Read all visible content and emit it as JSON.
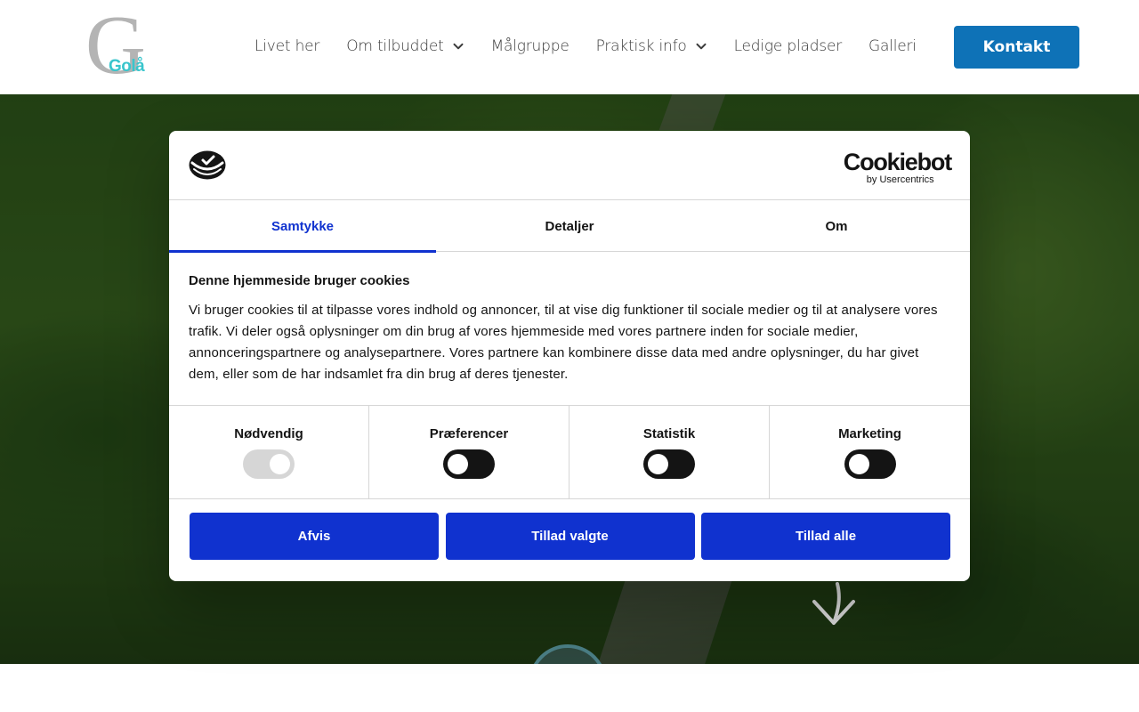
{
  "header": {
    "logo": {
      "letter": "G",
      "text": "Golå"
    },
    "nav": [
      {
        "label": "Livet her",
        "dropdown": false
      },
      {
        "label": "Om tilbuddet",
        "dropdown": true
      },
      {
        "label": "Målgruppe",
        "dropdown": false
      },
      {
        "label": "Praktisk info",
        "dropdown": true
      },
      {
        "label": "Ledige pladser",
        "dropdown": false
      },
      {
        "label": "Galleri",
        "dropdown": false
      }
    ],
    "cta_label": "Kontakt"
  },
  "cookie_dialog": {
    "brand": {
      "name": "Cookiebot",
      "subtitle": "by Usercentrics"
    },
    "tabs": [
      {
        "label": "Samtykke",
        "active": true
      },
      {
        "label": "Detaljer",
        "active": false
      },
      {
        "label": "Om",
        "active": false
      }
    ],
    "title": "Denne hjemmeside bruger cookies",
    "body": "Vi bruger cookies til at tilpasse vores indhold og annoncer, til at vise dig funktioner til sociale medier og til at analysere vores trafik. Vi deler også oplysninger om din brug af vores hjemmeside med vores partnere inden for sociale medier, annonceringspartnere og analysepartnere. Vores partnere kan kombinere disse data med andre oplysninger, du har givet dem, eller som de har indsamlet fra din brug af deres tjenester.",
    "toggles": [
      {
        "label": "Nødvendig",
        "checked": true,
        "disabled": true
      },
      {
        "label": "Præferencer",
        "checked": false,
        "disabled": false
      },
      {
        "label": "Statistik",
        "checked": false,
        "disabled": false
      },
      {
        "label": "Marketing",
        "checked": false,
        "disabled": false
      }
    ],
    "buttons": {
      "reject": "Afvis",
      "allow_selected": "Tillad valgte",
      "allow_all": "Tillad alle"
    }
  },
  "colors": {
    "primary_button": "#1032cf",
    "header_cta": "#0e72b7",
    "logo_gray": "#b4b4b4",
    "logo_teal": "#39c5cc",
    "toggle_off": "#141414",
    "toggle_disabled": "#d6d6d6"
  }
}
